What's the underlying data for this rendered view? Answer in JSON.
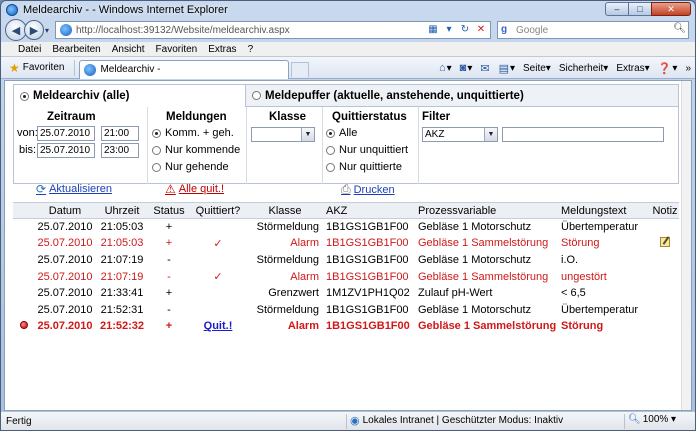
{
  "window": {
    "title": "Meldearchiv - - Windows Internet Explorer",
    "minimize": "–",
    "maximize": "□",
    "close": "✕"
  },
  "address": {
    "url": "http://localhost:39132/Website/meldearchiv.aspx",
    "search_placeholder": "Google"
  },
  "menu": [
    "Datei",
    "Bearbeiten",
    "Ansicht",
    "Favoriten",
    "Extras",
    "?"
  ],
  "favbar": {
    "favorites_label": "Favoriten",
    "tab_title": "Meldearchiv -",
    "commands": [
      "Seite",
      "Sicherheit",
      "Extras"
    ]
  },
  "tabs": {
    "archive": "Meldearchiv (alle)",
    "buffer": "Meldepuffer (aktuelle, anstehende, unquittierte)"
  },
  "filter": {
    "zeitraum_title": "Zeitraum",
    "from_label": "von:",
    "to_label": "bis:",
    "from_date": "25.07.2010",
    "from_time": "21:00",
    "to_date": "25.07.2010",
    "to_time": "23:00",
    "meldungen_title": "Meldungen",
    "meldungen_options": [
      "Komm. + geh.",
      "Nur kommende",
      "Nur gehende"
    ],
    "klasse_title": "Klasse",
    "klasse_value": "",
    "quitt_title": "Quittierstatus",
    "quitt_options": [
      "Alle",
      "Nur unquittiert",
      "Nur quittierte"
    ],
    "filter_title": "Filter",
    "filter_field": "AKZ",
    "filter_text": ""
  },
  "actions": {
    "refresh": "Aktualisieren",
    "ack_all": "Alle quit.!",
    "print": "Drucken"
  },
  "table": {
    "headers": [
      "Datum",
      "Uhrzeit",
      "Status",
      "Quittiert?",
      "Klasse",
      "AKZ",
      "Prozessvariable",
      "Meldungstext",
      "Notiz"
    ],
    "rows": [
      {
        "datum": "25.07.2010",
        "uhrzeit": "21:05:03",
        "status": "+",
        "quittiert": "",
        "klasse": "Störmeldung",
        "akz": "1B1GS1GB1F00",
        "pv": "Gebläse 1 Motorschutz",
        "text": "Übertemperatur",
        "style": "normal",
        "note": false
      },
      {
        "datum": "25.07.2010",
        "uhrzeit": "21:05:03",
        "status": "+",
        "quittiert": "✓",
        "klasse": "Alarm",
        "akz": "1B1GS1GB1F00",
        "pv": "Gebläse 1 Sammelstörung",
        "text": "Störung",
        "style": "alarm",
        "note": true
      },
      {
        "datum": "25.07.2010",
        "uhrzeit": "21:07:19",
        "status": "-",
        "quittiert": "",
        "klasse": "Störmeldung",
        "akz": "1B1GS1GB1F00",
        "pv": "Gebläse 1 Motorschutz",
        "text": "i.O.",
        "style": "normal",
        "note": false
      },
      {
        "datum": "25.07.2010",
        "uhrzeit": "21:07:19",
        "status": "-",
        "quittiert": "✓",
        "klasse": "Alarm",
        "akz": "1B1GS1GB1F00",
        "pv": "Gebläse 1 Sammelstörung",
        "text": "ungestört",
        "style": "alarm",
        "note": false
      },
      {
        "datum": "25.07.2010",
        "uhrzeit": "21:33:41",
        "status": "+",
        "quittiert": "",
        "klasse": "Grenzwert",
        "akz": "1M1ZV1PH1Q02",
        "pv": "Zulauf pH-Wert",
        "text": "< 6,5",
        "style": "normal",
        "note": false
      },
      {
        "datum": "25.07.2010",
        "uhrzeit": "21:52:31",
        "status": "-",
        "quittiert": "",
        "klasse": "Störmeldung",
        "akz": "1B1GS1GB1F00",
        "pv": "Gebläse 1 Motorschutz",
        "text": "Übertemperatur",
        "style": "normal",
        "note": false
      },
      {
        "datum": "25.07.2010",
        "uhrzeit": "21:52:32",
        "status": "+",
        "quittiert": "Quit.!",
        "klasse": "Alarm",
        "akz": "1B1GS1GB1F00",
        "pv": "Gebläse 1 Sammelstörung",
        "text": "Störung",
        "style": "active",
        "note": false
      }
    ]
  },
  "statusbar": {
    "text": "Fertig",
    "zone": "Lokales Intranet | Geschützter Modus: Inaktiv",
    "zoom": "100%"
  },
  "colors": {
    "alarm": "#d01818",
    "link": "#1a3fb8"
  }
}
